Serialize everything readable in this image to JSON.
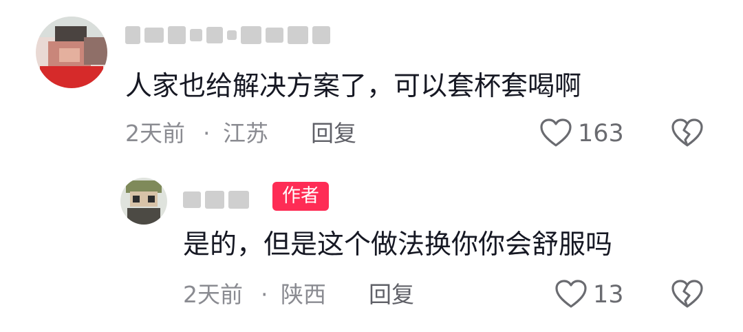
{
  "comment": {
    "text": "人家也给解决方案了，可以套杯套喝啊",
    "time": "2天前",
    "separator": "·",
    "location": "江苏",
    "reply_label": "回复",
    "like_count": "163"
  },
  "reply": {
    "author_badge": "作者",
    "text": "是的，但是这个做法换你你会舒服吗",
    "time": "2天前",
    "separator": "·",
    "location": "陕西",
    "reply_label": "回复",
    "like_count": "13"
  },
  "icons": {
    "like": "heart-outline-icon",
    "dislike": "broken-heart-icon"
  },
  "colors": {
    "badge": "#fe2c55",
    "text": "#161823",
    "meta": "#8a8b91"
  }
}
